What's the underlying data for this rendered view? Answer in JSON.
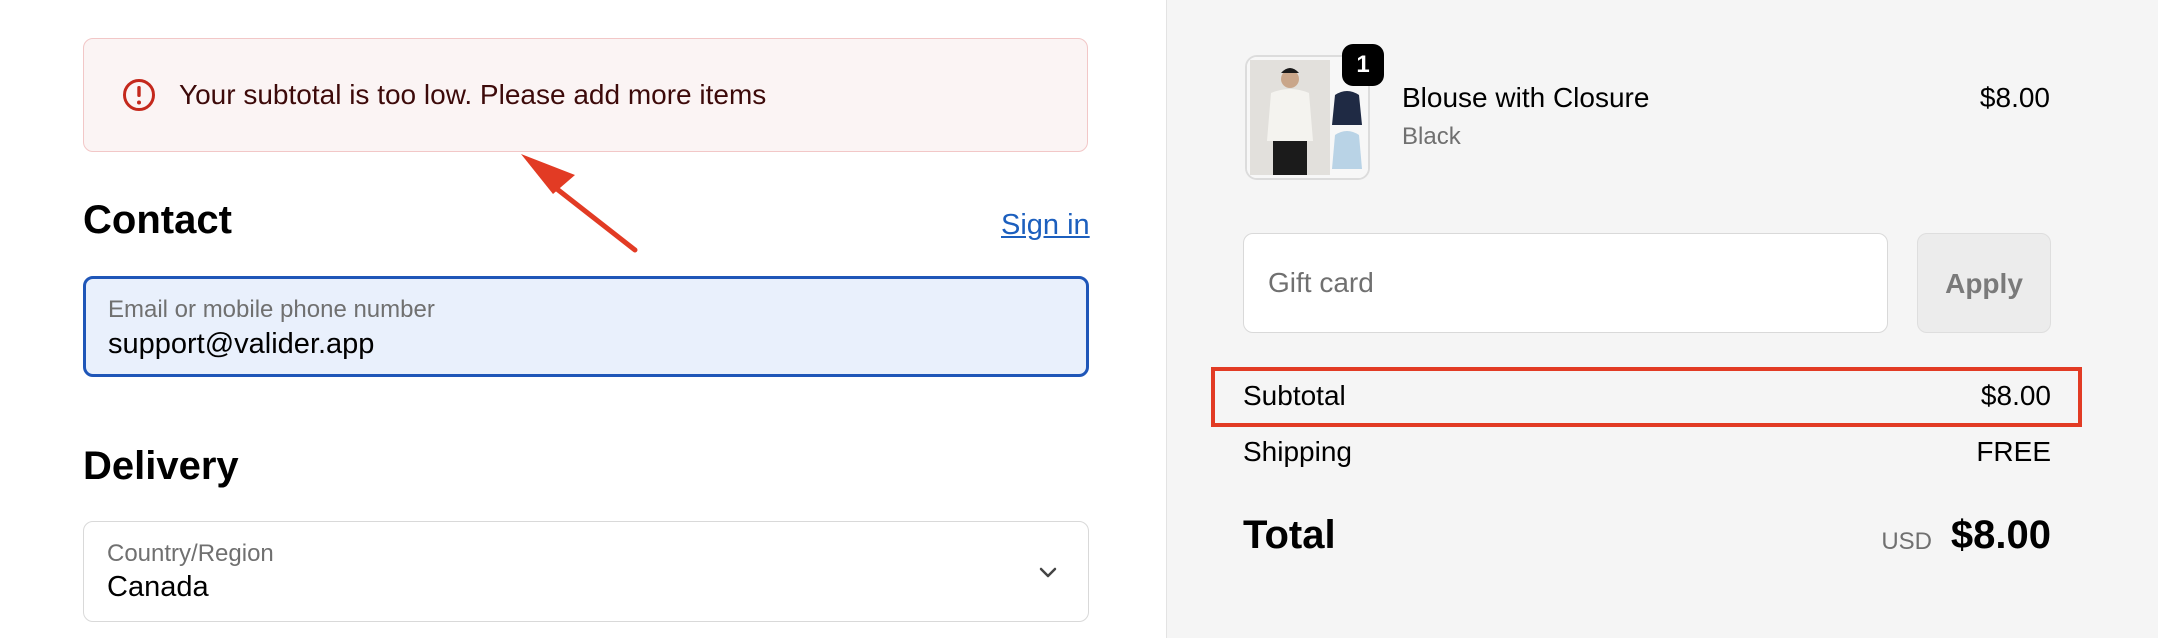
{
  "banner": {
    "icon": "alert-circle-icon",
    "message": "Your subtotal is too low. Please add more items"
  },
  "contact": {
    "heading": "Contact",
    "sign_in": "Sign in",
    "email_label": "Email or mobile phone number",
    "email_value": "support@valider.app"
  },
  "delivery": {
    "heading": "Delivery",
    "country_label": "Country/Region",
    "country_value": "Canada"
  },
  "cart": {
    "item": {
      "quantity": "1",
      "name": "Blouse with Closure",
      "variant": "Black",
      "price": "$8.00"
    }
  },
  "gift_card": {
    "placeholder": "Gift card",
    "apply_label": "Apply"
  },
  "summary": {
    "subtotal_label": "Subtotal",
    "subtotal_value": "$8.00",
    "shipping_label": "Shipping",
    "shipping_value": "FREE",
    "total_label": "Total",
    "currency": "USD",
    "total_value": "$8.00"
  },
  "colors": {
    "accent": "#1f56b8",
    "link": "#1c5fbe",
    "error_bg": "#fbf4f4",
    "annotation_red": "#e23b24"
  }
}
